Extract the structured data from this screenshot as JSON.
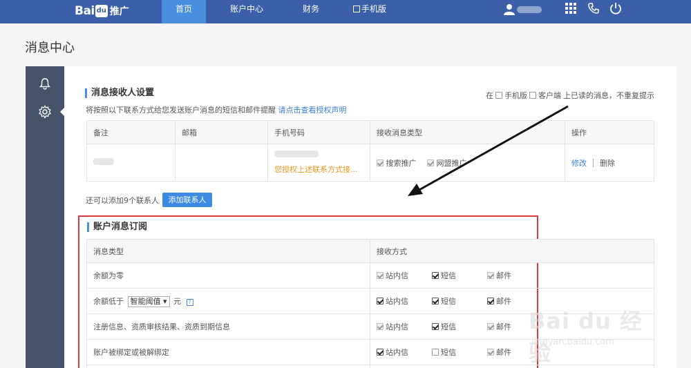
{
  "nav": {
    "logo_main": "Bai",
    "logo_paw": "du",
    "logo_sub": "推广",
    "tabs": [
      {
        "label": "首页",
        "active": true
      },
      {
        "label": "账户中心",
        "active": false
      },
      {
        "label": "财务",
        "active": false
      },
      {
        "label": "手机版",
        "active": false
      }
    ],
    "icons": [
      "user-icon",
      "grid-icon",
      "phone-icon",
      "power-icon"
    ]
  },
  "page": {
    "title": "消息中心"
  },
  "sidebar": {
    "icons": [
      "bell-icon",
      "gear-icon"
    ]
  },
  "receivers": {
    "title": "消息接收人设置",
    "desc": "将按照以下联系方式给您发送账户消息的短信和邮件提醒",
    "desc_link": "请点击查看授权声明",
    "option_prefix": "在",
    "option_mobile": "手机版",
    "option_client": "客户端",
    "option_suffix": "上已读的消息，不重复提示",
    "columns": [
      "备注",
      "邮箱",
      "手机号码",
      "接收消息类型",
      "操作"
    ],
    "row": {
      "phone_note": "您授权上述联系方式接...",
      "types": [
        "搜索推广",
        "网盟推广"
      ],
      "edit": "修改",
      "delete": "删除"
    },
    "add_text": "还可以添加9个联系人",
    "add_button": "添加联系人"
  },
  "subscription": {
    "title": "账户消息订阅",
    "columns": [
      "消息类型",
      "接收方式"
    ],
    "methods": [
      "站内信",
      "短信",
      "邮件"
    ],
    "rows": [
      {
        "label": "余额为零",
        "checks": [
          true,
          true,
          true
        ],
        "disabled": [
          true,
          false,
          true
        ]
      },
      {
        "label_prefix": "余额低于",
        "select": "智能阈值",
        "label_suffix": "元",
        "help": "?",
        "checks": [
          true,
          true,
          true
        ],
        "disabled": [
          false,
          false,
          false
        ]
      },
      {
        "label": "注册信息、资质审核结果、资质到期信息",
        "checks": [
          true,
          true,
          true
        ],
        "disabled": [
          true,
          false,
          true
        ]
      },
      {
        "label": "账户被绑定或被解绑定",
        "checks": [
          true,
          false,
          true
        ],
        "disabled": [
          false,
          false,
          true
        ]
      }
    ]
  },
  "watermark": {
    "main": "Bai du 经验",
    "sub": "jingyan.baidu.com"
  },
  "colors": {
    "nav_bg": "#3b5fa8",
    "active_tab": "#4a8ee0",
    "sidebar": "#46536a",
    "highlight": "#d9393d",
    "link": "#3b7dd8",
    "warn": "#e8961e"
  }
}
